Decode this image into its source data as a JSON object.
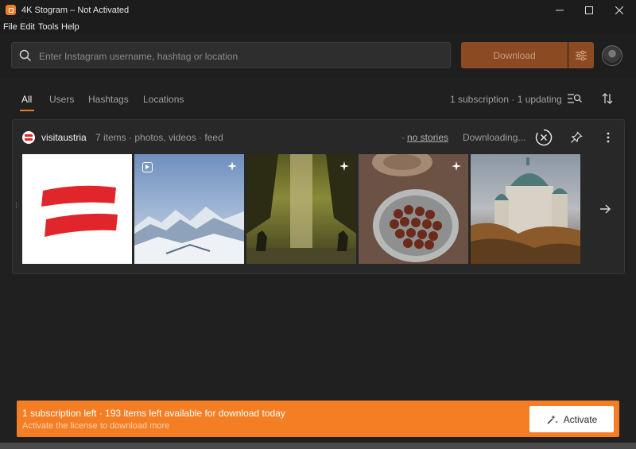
{
  "window": {
    "title": "4K Stogram – Not Activated"
  },
  "menu": {
    "items": [
      "File",
      "Edit",
      "Tools",
      "Help"
    ]
  },
  "search": {
    "placeholder": "Enter Instagram username, hashtag or location",
    "value": ""
  },
  "toolbar": {
    "download_label": "Download"
  },
  "tabs": [
    "All",
    "Users",
    "Hashtags",
    "Locations"
  ],
  "subscriptions_status": "1 subscription · 1 updating",
  "subscription": {
    "name": "visitaustria",
    "meta": "7 items · photos, videos · feed",
    "stories": "no stories",
    "stories_prefix": "·",
    "status": "Downloading..."
  },
  "banner": {
    "line1": "1 subscription left · 193 items left available for download today",
    "line2": "Activate the license to download more",
    "button": "Activate"
  },
  "colors": {
    "accent": "#f47e23",
    "download_button": "#8b4a22",
    "background": "#202020"
  },
  "icons": [
    "search-icon",
    "sliders-icon",
    "filter-search-icon",
    "sort-icon",
    "cancel-circle-icon",
    "pin-icon",
    "more-vertical-icon",
    "arrow-right-icon",
    "sparkle-icon",
    "reel-icon",
    "activate-icon"
  ]
}
